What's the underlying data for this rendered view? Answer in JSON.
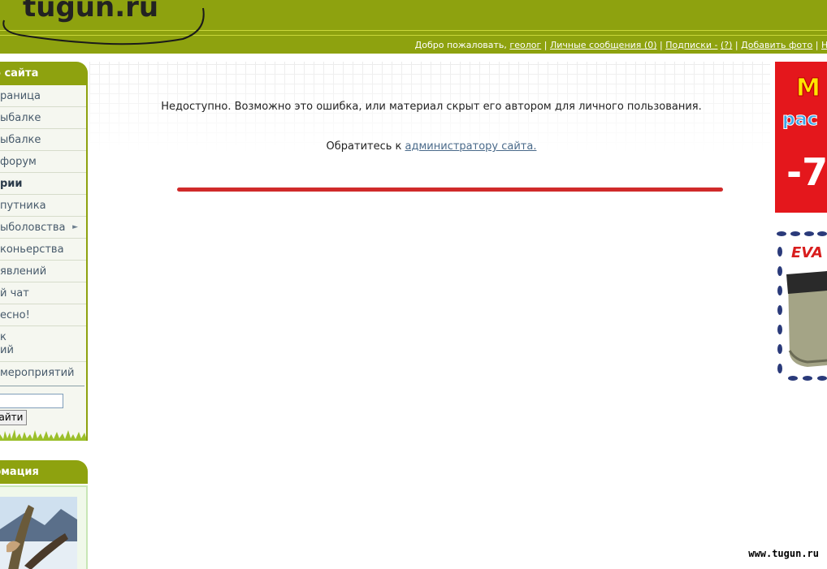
{
  "header": {
    "logo_text": "tugun.ru",
    "welcome_prefix": "Добро пожаловать,",
    "username": "геолог",
    "sep": "|",
    "messages_link": "Личные сообщения (0)",
    "subscriptions_label": "Подписки -",
    "subscriptions_count": "(?)",
    "add_photo_link": "Добавить фото",
    "next_link_fragment": "Но"
  },
  "sidebar": {
    "site_box_title": "о сайта",
    "items": [
      {
        "label": "раница"
      },
      {
        "label": "ыбалке"
      },
      {
        "label": "ыбалке"
      },
      {
        "label": "форум"
      },
      {
        "label": "рии"
      },
      {
        "label": "путника"
      },
      {
        "label": "ыболовства"
      },
      {
        "label": "коньерства"
      },
      {
        "label": "явлений"
      },
      {
        "label": "й чат"
      },
      {
        "label": "есно!"
      },
      {
        "label_line1": "к",
        "label_line2": "ий"
      },
      {
        "label": " мероприятий"
      }
    ],
    "search_button": "айти",
    "info_box_title": "рмация"
  },
  "main": {
    "message_unavailable": "Недоступно. Возможно это ошибка, или материал скрыт его автором для личного пользования.",
    "contact_prefix": "Обратитесь к",
    "contact_link": "администратору сайта."
  },
  "ads": {
    "ad1_text_top": "М",
    "ad1_text_mid": "рас",
    "ad1_text_big": "-7",
    "ad2_text": "EVA"
  },
  "footer": {
    "brand": "www.tugun.ru"
  },
  "colors": {
    "header_green": "#8ea20f",
    "accent_red": "#d02a2a",
    "link_blue": "#4a6a8a"
  }
}
